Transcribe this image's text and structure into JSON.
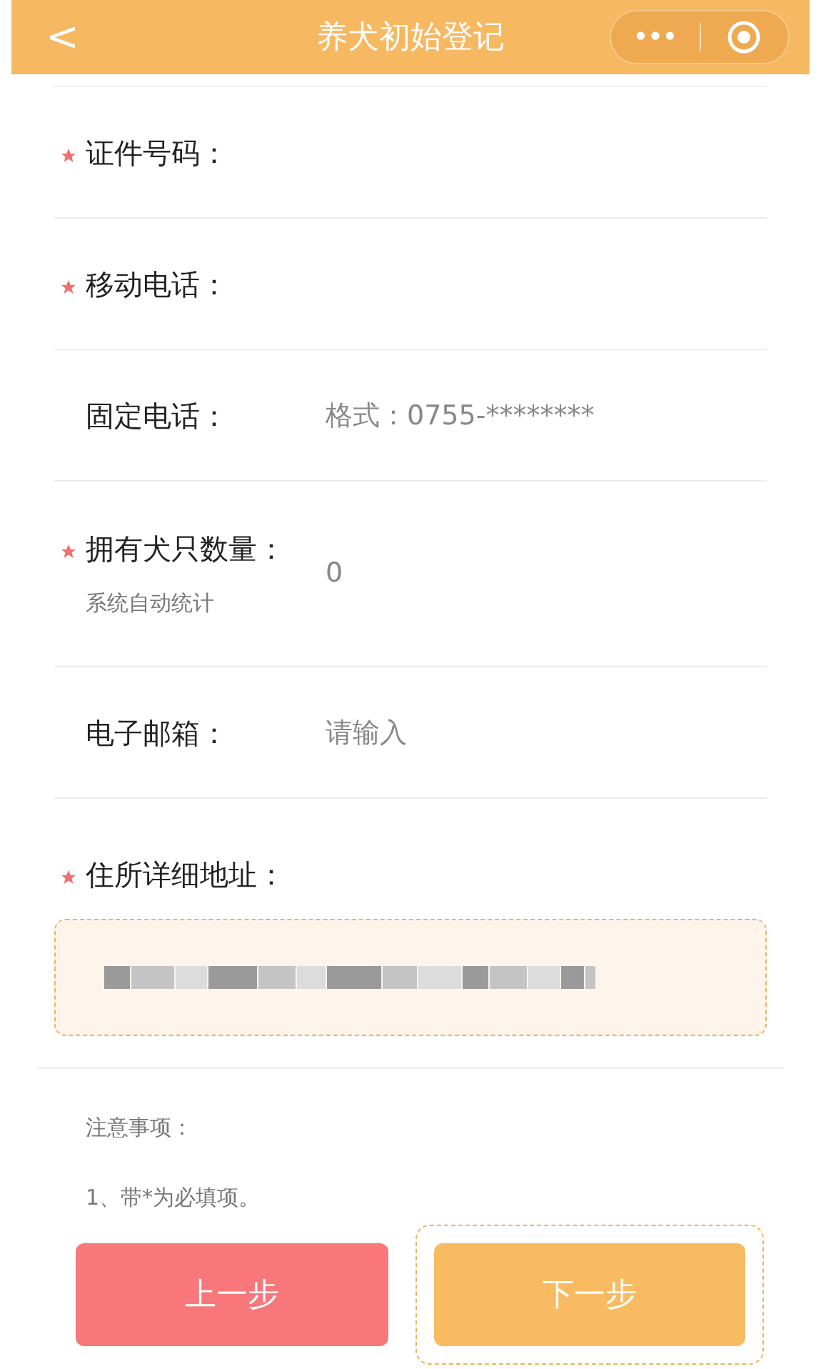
{
  "nav": {
    "back": "<",
    "title": "养犬初始登记",
    "more": "•••"
  },
  "fields": [
    {
      "kind": "input",
      "label": "证件号码：",
      "required": true
    },
    {
      "kind": "input",
      "label": "移动电话：",
      "required": true
    },
    {
      "kind": "input",
      "label": "固定电话：",
      "required": false,
      "placeholder": "格式：0755-********"
    },
    {
      "kind": "readonly",
      "label": "拥有犬只数量：",
      "required": true,
      "note": "系统自动统计",
      "value": "0"
    },
    {
      "kind": "input",
      "label": "电子邮箱：",
      "required": false,
      "placeholder": "请输入"
    },
    {
      "kind": "textarea",
      "label": "住所详细地址：",
      "required": true,
      "focused": true
    }
  ],
  "notes": {
    "title": "注意事项：",
    "items": [
      "1、带*为必填项。"
    ]
  },
  "buttons": [
    {
      "label": "上一步",
      "kind": "secondary",
      "focused": false
    },
    {
      "label": "下一步",
      "kind": "primary",
      "focused": true
    }
  ]
}
